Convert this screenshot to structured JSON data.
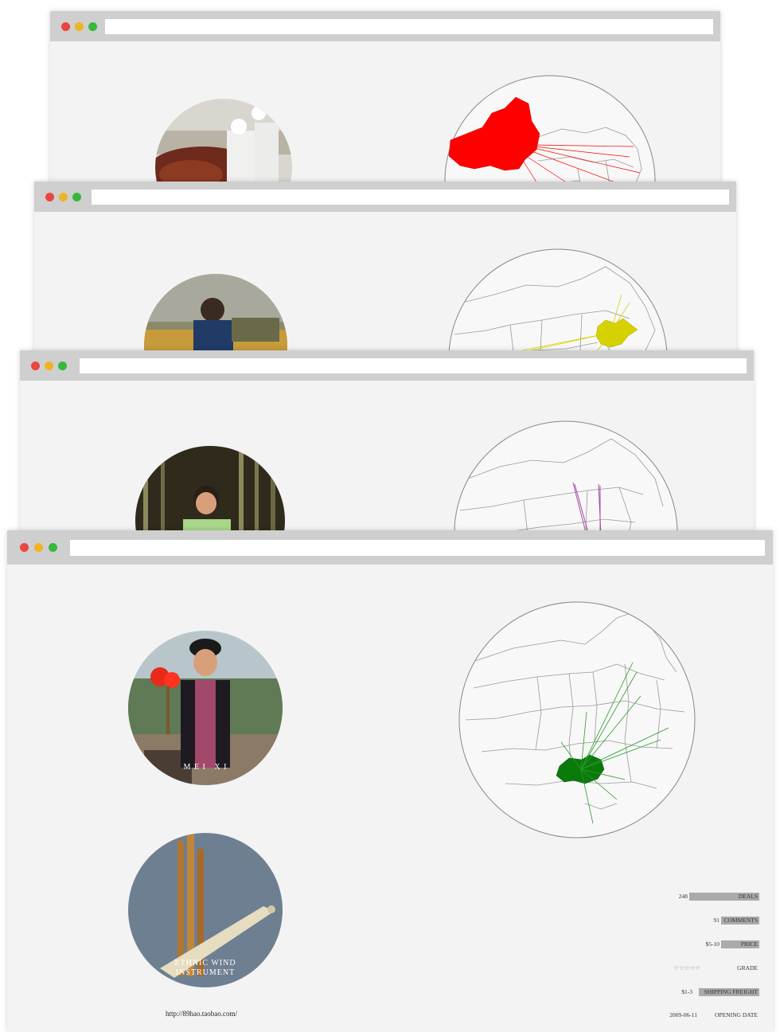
{
  "windows": [
    {
      "id": "window-1",
      "map_color": "#ff0000",
      "region": "xinjiang"
    },
    {
      "id": "window-2",
      "map_color": "#d6d100",
      "region": "shandong"
    },
    {
      "id": "window-3",
      "map_color": "#a64aa6",
      "region": "central"
    },
    {
      "id": "window-4",
      "map_color": "#0a7a0a",
      "region": "guizhou"
    }
  ],
  "traffic_lights": {
    "close": "#e9463f",
    "minimize": "#f0b323",
    "maximize": "#36b83a"
  },
  "shop": {
    "photo_caption_1": "M E I   X I",
    "photo_caption_2_line1": "ETHNIC WIND",
    "photo_caption_2_line2": "INSTRUMENT",
    "url": "http://89hao.taobao.com/",
    "stats": [
      {
        "value": "248",
        "label": "DEALS",
        "bar_fraction": 0.73
      },
      {
        "value": "91",
        "label": "COMMENTS",
        "bar_fraction": 0.4
      },
      {
        "value": "$5-10",
        "label": "PRICE",
        "bar_fraction": 0.4
      },
      {
        "value": "☆☆☆☆☆",
        "label": "GRADE",
        "bar_fraction": 0
      },
      {
        "value": "$1-3",
        "label": "SHIPPING FREIGHT",
        "bar_fraction": 0.63
      },
      {
        "value": "2009-06-11",
        "label": "OPENING DATE",
        "bar_fraction": 0
      }
    ]
  }
}
